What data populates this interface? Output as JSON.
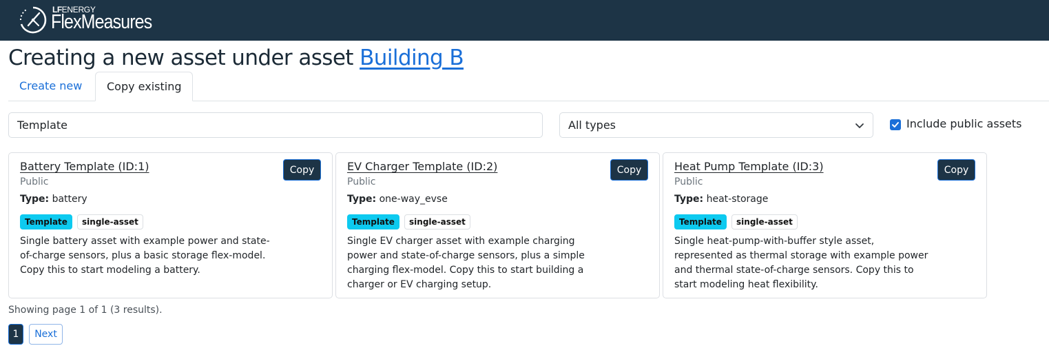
{
  "header": {
    "brand_small_prefix": "LF",
    "brand_small_suffix": "ENERGY",
    "brand_name": "FlexMeasures",
    "bg_color": "#1d3446"
  },
  "page": {
    "heading_prefix": "Creating a new asset under asset",
    "parent_asset_link": "Building B"
  },
  "tabs": [
    {
      "label": "Create new",
      "active": false
    },
    {
      "label": "Copy existing",
      "active": true
    }
  ],
  "filters": {
    "search_value": "Template",
    "type_select": "All types",
    "include_public_label": "Include public assets",
    "include_public_checked": true
  },
  "cards": [
    {
      "title": "Battery Template (ID:1)",
      "visibility": "Public",
      "type_label": "Type:",
      "type_value": "battery",
      "tags": [
        "Template",
        "single-asset"
      ],
      "description": "Single battery asset with example power and state-of-charge sensors, plus a basic storage flex-model. Copy this to start modeling a battery.",
      "button": "Copy"
    },
    {
      "title": "EV Charger Template (ID:2)",
      "visibility": "Public",
      "type_label": "Type:",
      "type_value": "one-way_evse",
      "tags": [
        "Template",
        "single-asset"
      ],
      "description": "Single EV charger asset with example charging power and state-of-charge sensors, plus a simple charging flex-model. Copy this to start building a charger or EV charging setup.",
      "button": "Copy"
    },
    {
      "title": "Heat Pump Template (ID:3)",
      "visibility": "Public",
      "type_label": "Type:",
      "type_value": "heat-storage",
      "tags": [
        "Template",
        "single-asset"
      ],
      "description": "Single heat-pump-with-buffer style asset, represented as thermal storage with example power and thermal state-of-charge sensors. Copy this to start modeling heat flexibility.",
      "button": "Copy"
    }
  ],
  "pagination": {
    "info": "Showing page 1 of 1 (3 results).",
    "current_page": "1",
    "next_label": "Next"
  },
  "colors": {
    "accent": "#1a6fd8",
    "template_tag": "#0dcaf0"
  }
}
